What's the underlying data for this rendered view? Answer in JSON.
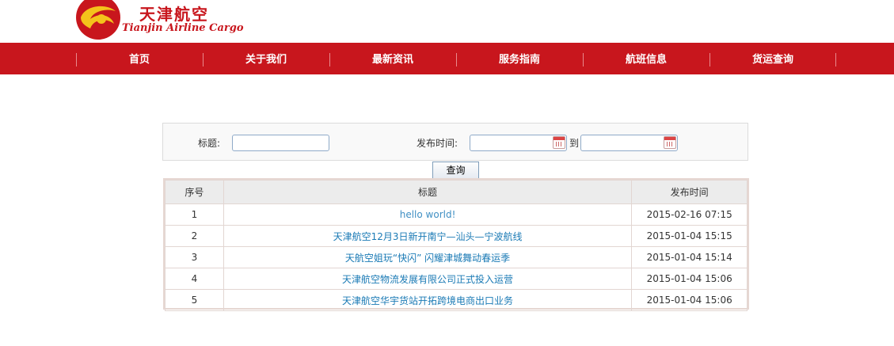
{
  "brand": {
    "name_cn": "天津航空",
    "name_en": "Tianjin Airline Cargo",
    "accent_color": "#c8161d"
  },
  "nav": {
    "items": [
      {
        "label": "首页"
      },
      {
        "label": "关于我们"
      },
      {
        "label": "最新资讯"
      },
      {
        "label": "服务指南"
      },
      {
        "label": "航班信息"
      },
      {
        "label": "货运查询"
      }
    ]
  },
  "search": {
    "title_label": "标题:",
    "title_value": "",
    "date_label": "发布时间:",
    "date_from": "",
    "date_to": "",
    "to_label": "到",
    "button_label": "查询",
    "calendar_icon": "calendar-icon"
  },
  "table": {
    "headers": [
      "序号",
      "标题",
      "发布时间"
    ],
    "rows": [
      {
        "no": "1",
        "title": "hello world!",
        "date": "2015-02-16 07:15"
      },
      {
        "no": "2",
        "title": "天津航空12月3日新开南宁—汕头—宁波航线",
        "date": "2015-01-04 15:15"
      },
      {
        "no": "3",
        "title": "天航空姐玩“快闪” 闪耀津城舞动春运季",
        "date": "2015-01-04 15:14"
      },
      {
        "no": "4",
        "title": "天津航空物流发展有限公司正式投入运营",
        "date": "2015-01-04 15:06"
      },
      {
        "no": "5",
        "title": "天津航空华宇货站开拓跨境电商出口业务",
        "date": "2015-01-04 15:06"
      }
    ]
  }
}
